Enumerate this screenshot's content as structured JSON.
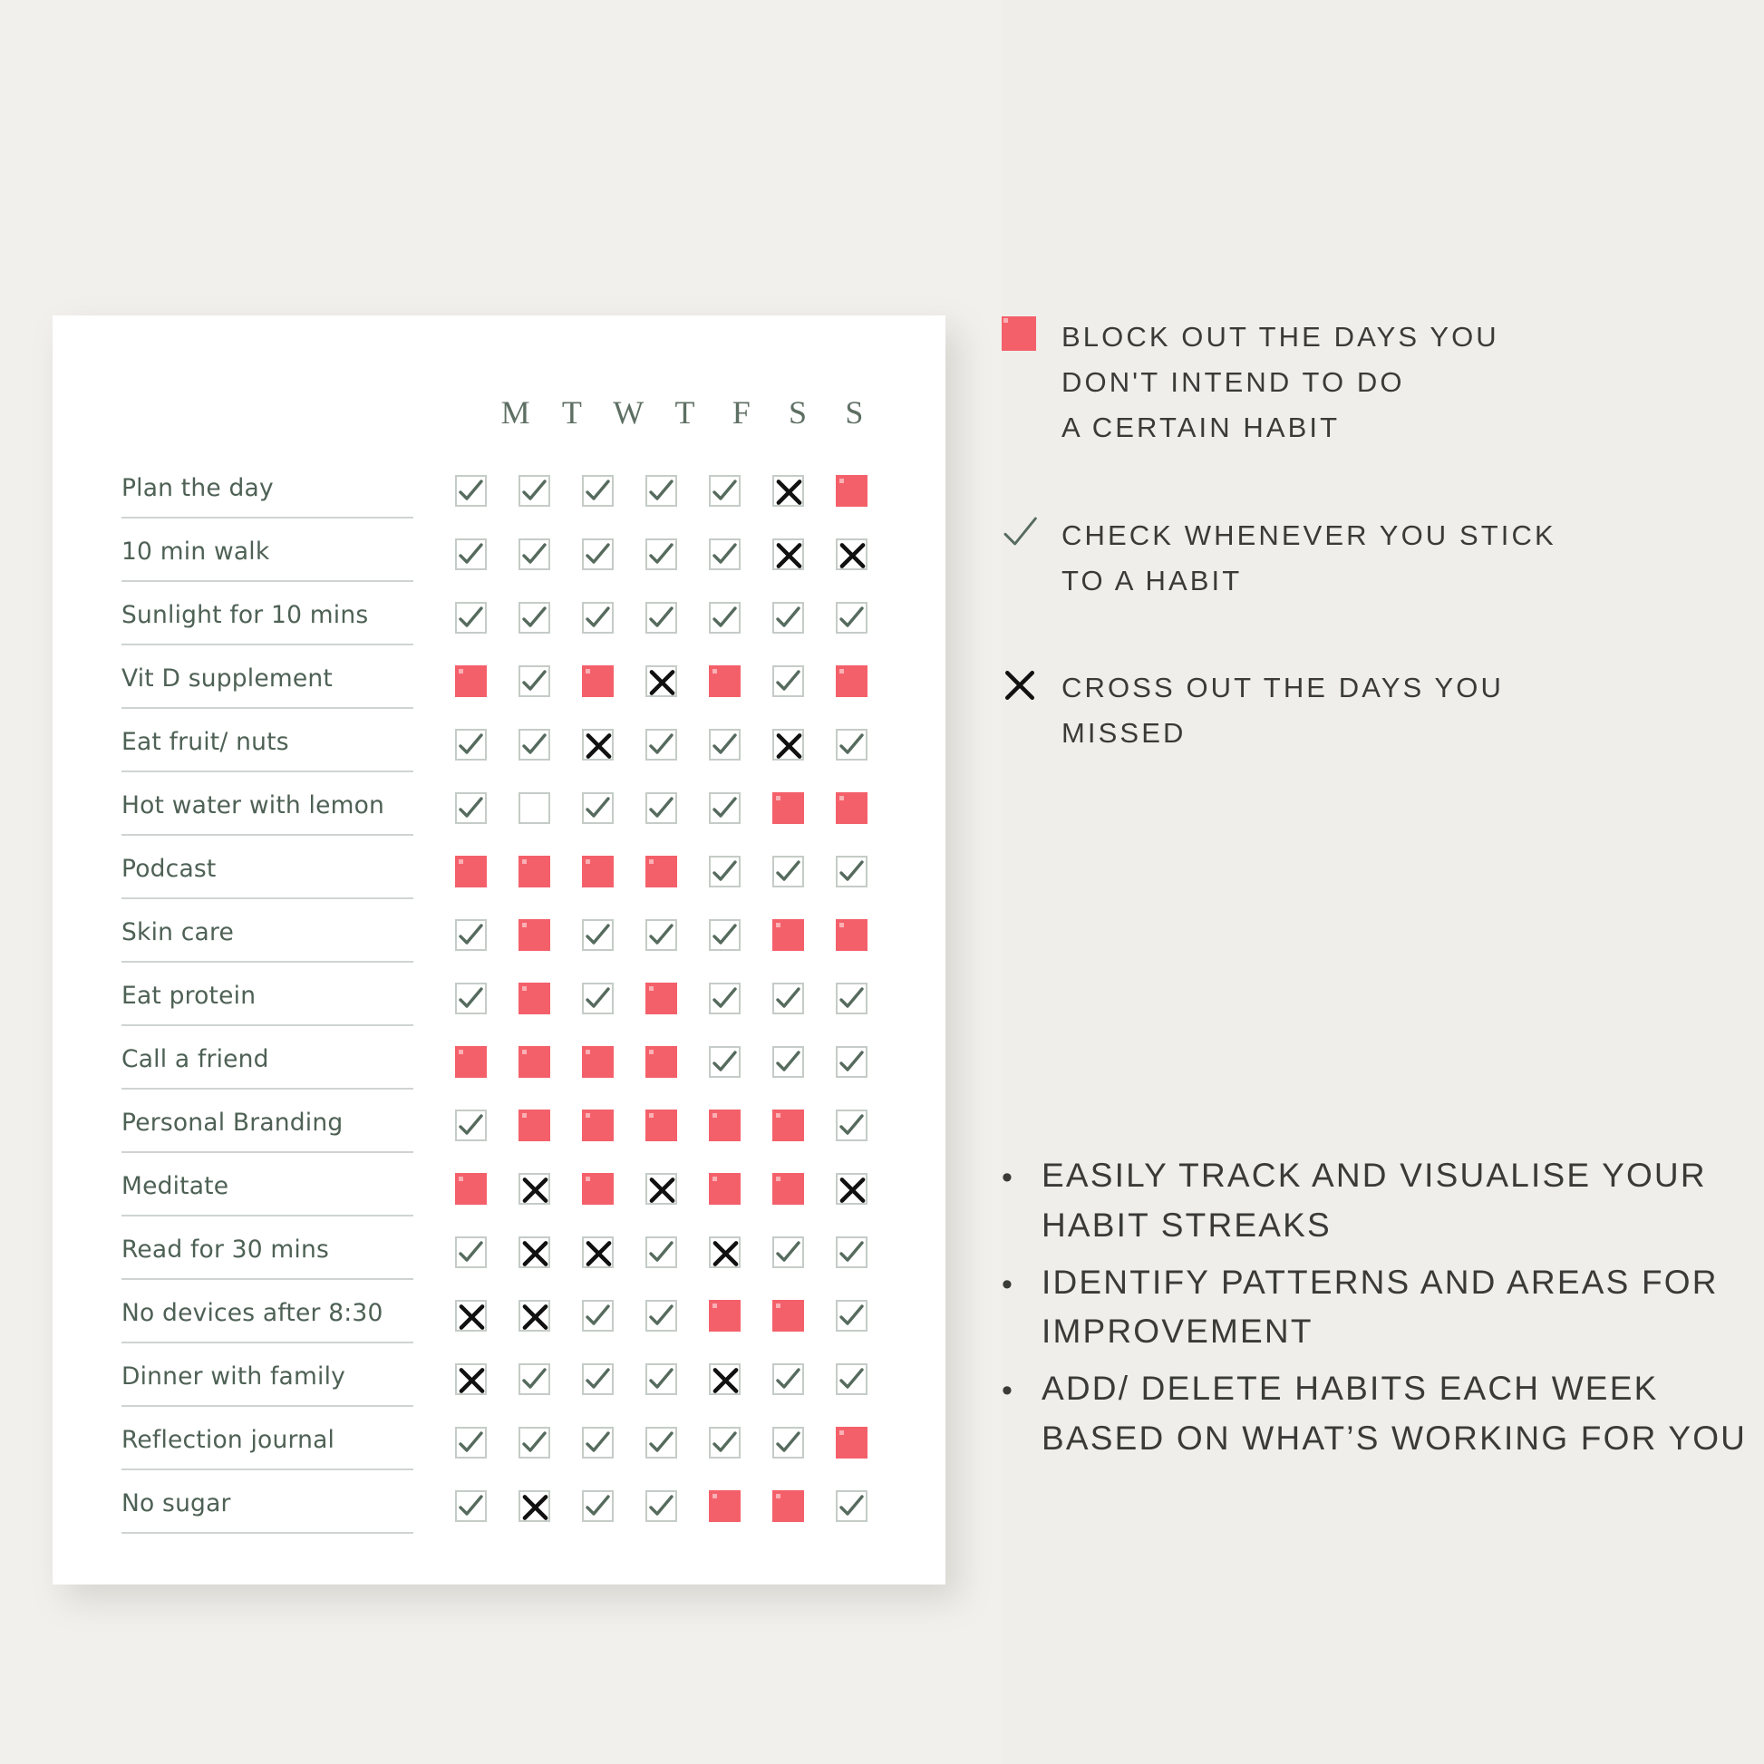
{
  "colors": {
    "background": "#efeeea",
    "sheet": "#ffffff",
    "blocked_red": "#f4606a",
    "check_green": "#566b5e",
    "cross_black": "#111111",
    "rule_gray": "#cfd4d0",
    "text_dark": "#3a3a38",
    "habit_text": "#4e6155"
  },
  "tracker": {
    "day_headers": [
      "M",
      "T",
      "W",
      "T",
      "F",
      "S",
      "S"
    ],
    "rows": [
      {
        "label": "Plan the day",
        "cells": [
          "check",
          "check",
          "check",
          "check",
          "check",
          "cross",
          "blocked"
        ]
      },
      {
        "label": "10 min walk",
        "cells": [
          "check",
          "check",
          "check",
          "check",
          "check",
          "cross",
          "cross"
        ]
      },
      {
        "label": "Sunlight for 10 mins",
        "cells": [
          "check",
          "check",
          "check",
          "check",
          "check",
          "check",
          "check"
        ]
      },
      {
        "label": "Vit D supplement",
        "cells": [
          "blocked",
          "check",
          "blocked",
          "cross",
          "blocked",
          "check",
          "blocked"
        ]
      },
      {
        "label": "Eat fruit/ nuts",
        "cells": [
          "check",
          "check",
          "cross",
          "check",
          "check",
          "cross",
          "check"
        ]
      },
      {
        "label": "Hot water with lemon",
        "cells": [
          "check",
          "empty",
          "check",
          "check",
          "check",
          "blocked",
          "blocked"
        ]
      },
      {
        "label": "Podcast",
        "cells": [
          "blocked",
          "blocked",
          "blocked",
          "blocked",
          "check",
          "check",
          "check"
        ]
      },
      {
        "label": "Skin care",
        "cells": [
          "check",
          "blocked",
          "check",
          "check",
          "check",
          "blocked",
          "blocked"
        ]
      },
      {
        "label": "Eat protein",
        "cells": [
          "check",
          "blocked",
          "check",
          "blocked",
          "check",
          "check",
          "check"
        ]
      },
      {
        "label": "Call a friend",
        "cells": [
          "blocked",
          "blocked",
          "blocked",
          "blocked",
          "check",
          "check",
          "check"
        ]
      },
      {
        "label": "Personal Branding",
        "cells": [
          "check",
          "blocked",
          "blocked",
          "blocked",
          "blocked",
          "blocked",
          "check"
        ]
      },
      {
        "label": "Meditate",
        "cells": [
          "blocked",
          "cross",
          "blocked",
          "cross",
          "blocked",
          "blocked",
          "cross"
        ]
      },
      {
        "label": "Read for 30 mins",
        "cells": [
          "check",
          "cross",
          "cross",
          "check",
          "cross",
          "check",
          "check"
        ]
      },
      {
        "label": "No devices after 8:30",
        "cells": [
          "cross",
          "cross",
          "check",
          "check",
          "blocked",
          "blocked",
          "check"
        ]
      },
      {
        "label": "Dinner with family",
        "cells": [
          "cross",
          "check",
          "check",
          "check",
          "cross",
          "check",
          "check"
        ]
      },
      {
        "label": "Reflection journal",
        "cells": [
          "check",
          "check",
          "check",
          "check",
          "check",
          "check",
          "blocked"
        ]
      },
      {
        "label": "No sugar",
        "cells": [
          "check",
          "cross",
          "check",
          "check",
          "blocked",
          "blocked",
          "check"
        ]
      }
    ]
  },
  "legend": [
    {
      "icon": "red-square-icon",
      "mark": "blocked",
      "lines": [
        "BLOCK OUT THE DAYS YOU",
        "DON'T INTEND TO DO",
        "A CERTAIN HABIT"
      ]
    },
    {
      "icon": "check-icon",
      "mark": "check",
      "lines": [
        "CHECK WHENEVER YOU STICK",
        "TO A HABIT"
      ]
    },
    {
      "icon": "cross-icon",
      "mark": "cross",
      "lines": [
        "CROSS OUT THE DAYS YOU",
        "MISSED"
      ]
    }
  ],
  "benefits": {
    "bullet_glyph": "•",
    "items": [
      "EASILY TRACK AND VISUALISE YOUR HABIT STREAKS",
      "IDENTIFY PATTERNS AND AREAS FOR IMPROVEMENT",
      "ADD/ DELETE HABITS EACH WEEK BASED ON WHAT’S WORKING FOR YOU"
    ]
  }
}
